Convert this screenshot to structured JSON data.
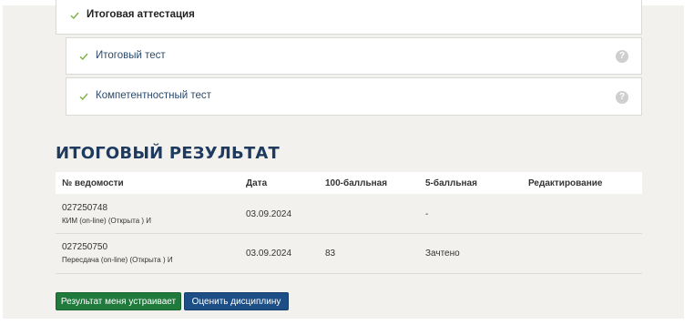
{
  "colors": {
    "check": "#7cb342",
    "heading": "#1e3a5f",
    "button_primary": "#1f7a3c",
    "button_secondary": "#1d4f86",
    "help_icon": "#cfcfcf"
  },
  "attestation": {
    "title": "Итоговая аттестация",
    "items": [
      {
        "label": "Итоговый тест",
        "help": "?"
      },
      {
        "label": "Компетентностный тест",
        "help": "?"
      }
    ]
  },
  "result": {
    "title": "ИТОГОВЫЙ РЕЗУЛЬТАТ",
    "columns": [
      "№ ведомости",
      "Дата",
      "100-балльная",
      "5-балльная",
      "Редактирование"
    ],
    "rows": [
      {
        "number": "027250748",
        "note": "КИМ (on-line) (Открыта ) И",
        "date": "03.09.2024",
        "score100": "",
        "score5": "-",
        "edit": ""
      },
      {
        "number": "027250750",
        "note": "Пересдача (on-line) (Открыта ) И",
        "date": "03.09.2024",
        "score100": "83",
        "score5": "Зачтено",
        "edit": ""
      }
    ]
  },
  "buttons": {
    "accept": "Результат меня устраивает",
    "rate": "Оценить дисциплину"
  }
}
